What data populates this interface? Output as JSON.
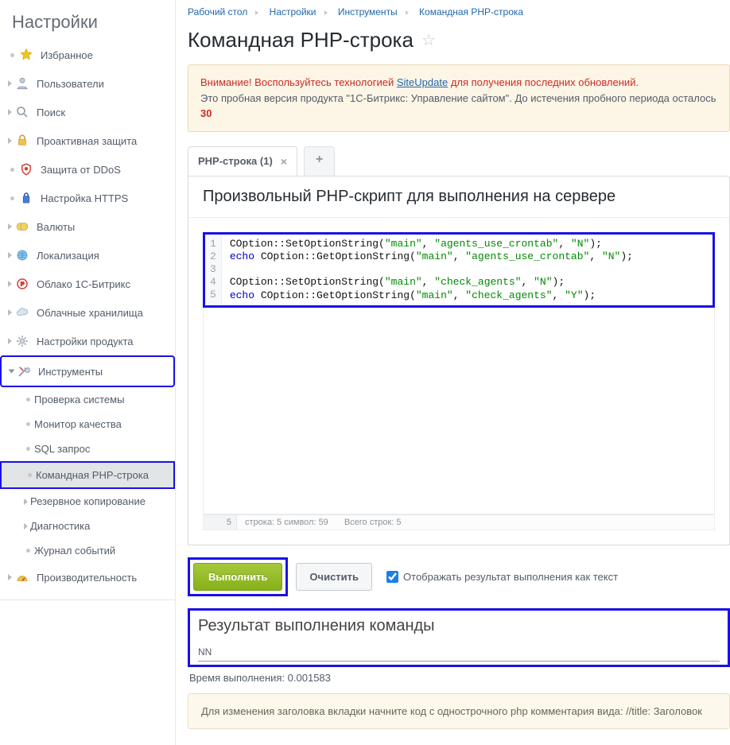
{
  "sidebar": {
    "title": "Настройки",
    "items": [
      {
        "label": "Избранное",
        "icon": "star"
      },
      {
        "label": "Пользователи",
        "icon": "users"
      },
      {
        "label": "Поиск",
        "icon": "search"
      },
      {
        "label": "Проактивная защита",
        "icon": "lock"
      },
      {
        "label": "Защита от DDoS",
        "icon": "shield"
      },
      {
        "label": "Настройка HTTPS",
        "icon": "https"
      },
      {
        "label": "Валюты",
        "icon": "currency"
      },
      {
        "label": "Локализация",
        "icon": "globe"
      },
      {
        "label": "Облако 1С-Битрикс",
        "icon": "cloud-b"
      },
      {
        "label": "Облачные хранилища",
        "icon": "cloud"
      },
      {
        "label": "Настройки продукта",
        "icon": "gear"
      },
      {
        "label": "Инструменты",
        "icon": "tools"
      }
    ],
    "tools_sub": [
      {
        "label": "Проверка системы"
      },
      {
        "label": "Монитор качества"
      },
      {
        "label": "SQL запрос"
      },
      {
        "label": "Командная PHP-строка"
      },
      {
        "label": "Резервное копирование"
      },
      {
        "label": "Диагностика"
      },
      {
        "label": "Журнал событий"
      }
    ],
    "perf": {
      "label": "Производительность"
    }
  },
  "breadcrumb": [
    "Рабочий стол",
    "Настройки",
    "Инструменты",
    "Командная PHP-строка"
  ],
  "page": {
    "title": "Командная PHP-строка"
  },
  "alert": {
    "prefix": "Внимание! Воспользуйтесь технологией ",
    "link": "SiteUpdate",
    "suffix": " для получения последних обновлений.",
    "line2_a": "Это пробная версия продукта \"1С-Битрикс: Управление сайтом\". До истечения пробного периода осталось ",
    "days": "30"
  },
  "tab": {
    "label": "PHP-строка (1)",
    "add": "+"
  },
  "panel": {
    "title": "Произвольный PHP-скрипт для выполнения на сервере"
  },
  "editor": {
    "gutter": [
      "1",
      "2",
      "3",
      "4",
      "5"
    ],
    "lines": [
      {
        "t": "call",
        "fn": "COption::SetOptionString",
        "a1": "\"main\"",
        "a2": "\"agents_use_crontab\"",
        "a3": "\"N\""
      },
      {
        "t": "echo",
        "fn": "COption::GetOptionString",
        "a1": "\"main\"",
        "a2": "\"agents_use_crontab\"",
        "a3": "\"N\""
      },
      {
        "t": "blank"
      },
      {
        "t": "call",
        "fn": "COption::SetOptionString",
        "a1": "\"main\"",
        "a2": "\"check_agents\"",
        "a3": "\"N\""
      },
      {
        "t": "echo",
        "fn": "COption::GetOptionString",
        "a1": "\"main\"",
        "a2": "\"check_agents\"",
        "a3": "\"Y\""
      }
    ],
    "status": {
      "current_line": "5",
      "row_col": "строка: 5    символ: 59",
      "total": "Всего строк: 5"
    }
  },
  "buttons": {
    "exec": "Выполнить",
    "clear": "Очистить",
    "as_text": "Отображать результат выполнения как текст"
  },
  "result": {
    "title": "Результат выполнения команды",
    "body": "NN",
    "time_label": "Время выполнения: ",
    "time": "0.001583"
  },
  "hint": "Для изменения заголовка вкладки начните код с однострочного php комментария вида: //title: Заголовок"
}
